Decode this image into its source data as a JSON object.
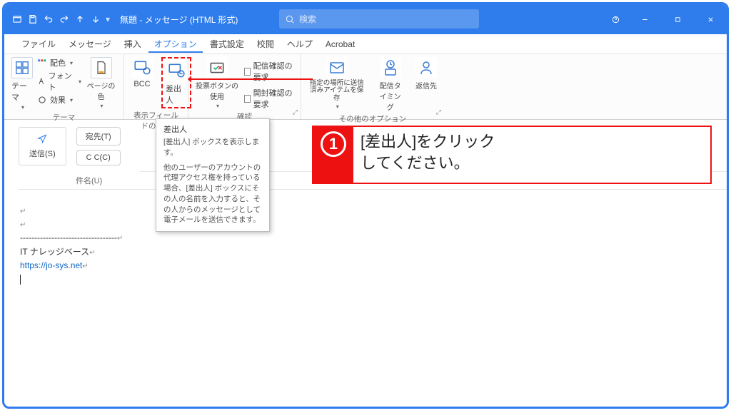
{
  "titlebar": {
    "title": "無題 - メッセージ (HTML 形式)",
    "search_placeholder": "検索"
  },
  "menu": {
    "items": [
      "ファイル",
      "メッセージ",
      "挿入",
      "オプション",
      "書式設定",
      "校閲",
      "ヘルプ",
      "Acrobat"
    ],
    "active": "オプション"
  },
  "ribbon": {
    "theme": {
      "big": "テーマ",
      "items": [
        "配色",
        "フォント",
        "効果"
      ],
      "pagecolor": "ページの色",
      "group_label": "テーマ"
    },
    "showfields": {
      "bcc": "BCC",
      "from": "差出人",
      "group_label": "表示フィールドの選択"
    },
    "confirm": {
      "voting": "投票ボタンの使用",
      "req_delivery": "配信確認の要求",
      "req_read": "開封確認の要求",
      "group_label": "確認"
    },
    "other": {
      "save_sent": "指定の場所に送信済みアイテムを保存",
      "delay": "配信タイミング",
      "replyto": "返信先",
      "group_label": "その他のオプション"
    }
  },
  "tooltip": {
    "title": "差出人",
    "line1": "[差出人] ボックスを表示します。",
    "line2": "他のユーザーのアカウントの代理アクセス権を持っている場合、[差出人] ボックスにその人の名前を入力すると、その人からのメッセージとして電子メールを送信できます。"
  },
  "compose": {
    "send": "送信(S)",
    "to": "宛先(T)",
    "cc": "C C(C)",
    "subject": "件名(U)"
  },
  "body": {
    "sig_divider": "----------------------------------",
    "sig_name": "IT ナレッジベース",
    "sig_url": "https://jo-sys.net"
  },
  "callout": {
    "num": "1",
    "text_l1": "[差出人]をクリック",
    "text_l2": "してください。"
  }
}
